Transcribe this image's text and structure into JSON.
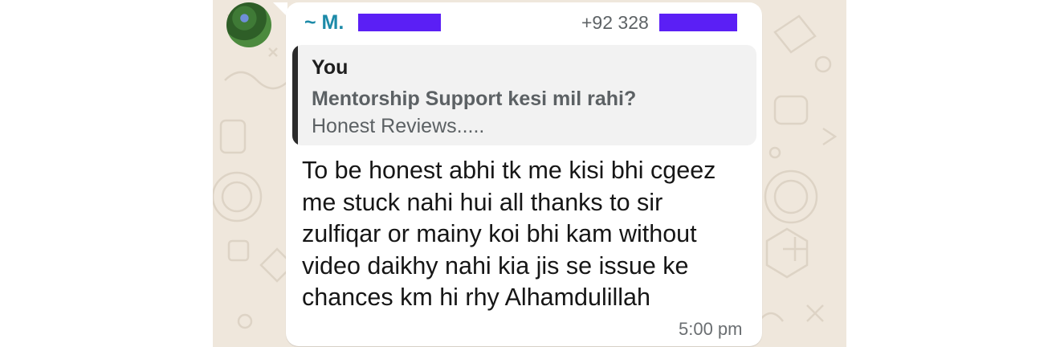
{
  "message": {
    "sender_prefix": "~ M.",
    "sender_phone": "+92 328",
    "quoted": {
      "author": "You",
      "line1": "Mentorship Support kesi mil rahi?",
      "line2": "Honest Reviews....."
    },
    "text_lines": [
      "To be honest abhi tk me kisi bhi cgeez",
      "me stuck nahi hui all thanks to sir",
      "zulfiqar or mainy koi bhi kam without",
      "video daikhy nahi kia jis se issue ke",
      "chances km hi rhy Alhamdulillah"
    ],
    "time": "5:00 pm"
  },
  "colors": {
    "chat_background": "#efe7dc",
    "sender_name": "#1c8aa8",
    "redaction": "#5b1ff5",
    "bubble": "#ffffff",
    "quote_background": "#f2f2f2",
    "quote_bar": "#2b2b2b"
  },
  "icons": {
    "avatar": "profile-photo-avatar"
  }
}
